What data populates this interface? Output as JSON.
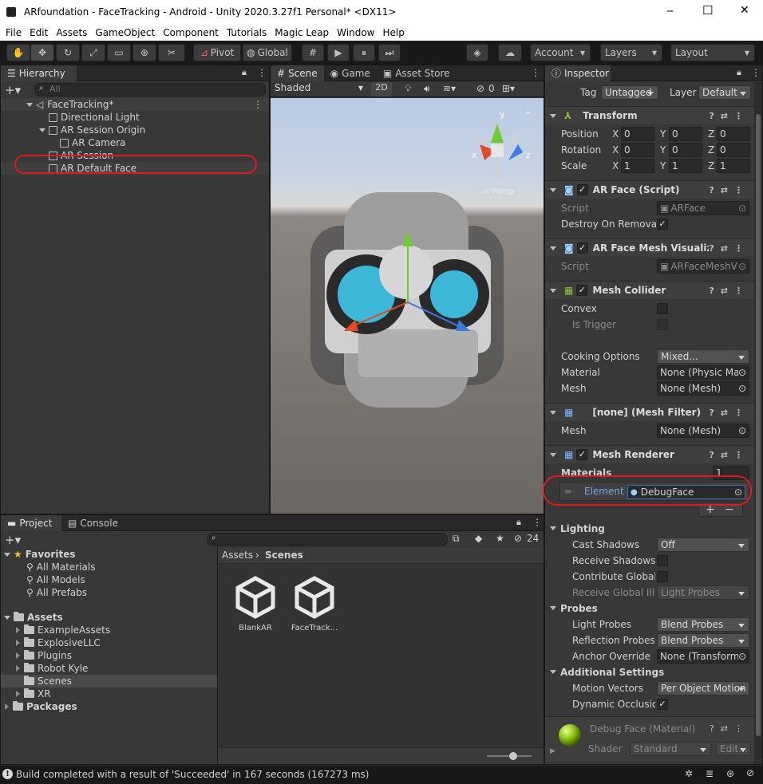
{
  "window": {
    "title": "ARfoundation - FaceTracking - Android - Unity 2020.3.27f1 Personal* <DX11>",
    "minimize": "─",
    "maximize": "☐",
    "close": "✕"
  },
  "menu": [
    "File",
    "Edit",
    "Assets",
    "GameObject",
    "Component",
    "Tutorials",
    "Magic Leap",
    "Window",
    "Help"
  ],
  "toolbar": {
    "pivot": "Pivot",
    "global": "Global",
    "account": "Account",
    "layers": "Layers",
    "layout": "Layout"
  },
  "hierarchy": {
    "tab": "Hierarchy",
    "search_placeholder": "All",
    "scene": "FaceTracking*",
    "items": [
      "Directional Light",
      "AR Session Origin",
      "AR Camera",
      "AR Session",
      "AR Default Face"
    ]
  },
  "scene": {
    "tabs": [
      "Scene",
      "Game",
      "Asset Store"
    ],
    "shading": "Shaded",
    "mode2d": "2D",
    "hidden_count": "0",
    "gizmo_y": "y",
    "gizmo_x": "x",
    "gizmo_z": "z",
    "persp": "< Persp"
  },
  "inspector": {
    "tab": "Inspector",
    "tag_label": "Tag",
    "tag_value": "Untagged",
    "layer_label": "Layer",
    "layer_value": "Default",
    "transform": {
      "title": "Transform",
      "position": "Position",
      "rotation": "Rotation",
      "scale": "Scale",
      "x": "X",
      "y": "Y",
      "z": "Z",
      "pos": [
        "0",
        "0",
        "0"
      ],
      "rot": [
        "0",
        "0",
        "0"
      ],
      "scl": [
        "1",
        "1",
        "1"
      ]
    },
    "arface": {
      "title": "AR Face (Script)",
      "script_label": "Script",
      "script_value": "ARFace",
      "destroy": "Destroy On Removal"
    },
    "armesh": {
      "title": "AR Face Mesh Visualize",
      "script_label": "Script",
      "script_value": "ARFaceMeshV"
    },
    "collider": {
      "title": "Mesh Collider",
      "convex": "Convex",
      "trigger": "Is Trigger",
      "cooking": "Cooking Options",
      "cooking_value": "Mixed...",
      "material": "Material",
      "material_value": "None (Physic Ma",
      "mesh": "Mesh",
      "mesh_value": "None (Mesh)"
    },
    "filter": {
      "title": "[none] (Mesh Filter)",
      "mesh": "Mesh",
      "mesh_value": "None (Mesh)"
    },
    "renderer": {
      "title": "Mesh Renderer",
      "materials": "Materials",
      "count": "1",
      "element": "Element (",
      "element_value": "DebugFace",
      "plus": "+",
      "minus": "−",
      "lighting": "Lighting",
      "cast": "Cast Shadows",
      "cast_value": "Off",
      "receive": "Receive Shadows",
      "contribute": "Contribute Global I",
      "receive_gi": "Receive Global Illu",
      "receive_gi_value": "Light Probes",
      "probes": "Probes",
      "light_probes": "Light Probes",
      "light_probes_value": "Blend Probes",
      "refl": "Reflection Probes",
      "refl_value": "Blend Probes",
      "anchor": "Anchor Override",
      "anchor_value": "None (Transform",
      "additional": "Additional Settings",
      "motion": "Motion Vectors",
      "motion_value": "Per Object Motion",
      "dynamic": "Dynamic Occlusion"
    },
    "material": {
      "title": "Debug Face (Material)",
      "shader_label": "Shader",
      "shader_value": "Standard",
      "edit": "Edit..."
    }
  },
  "project": {
    "tabs": [
      "Project",
      "Console"
    ],
    "hidden_count": "24",
    "favorites": "Favorites",
    "fav_items": [
      "All Materials",
      "All Models",
      "All Prefabs"
    ],
    "assets": "Assets",
    "asset_folders": [
      "ExampleAssets",
      "ExplosiveLLC",
      "Plugins",
      "Robot Kyle",
      "Scenes",
      "XR"
    ],
    "packages": "Packages",
    "breadcrumb": [
      "Assets",
      "Scenes"
    ],
    "files": [
      "BlankAR",
      "FaceTrack..."
    ]
  },
  "status": "Build completed with a result of 'Succeeded' in 167 seconds (167273 ms)"
}
